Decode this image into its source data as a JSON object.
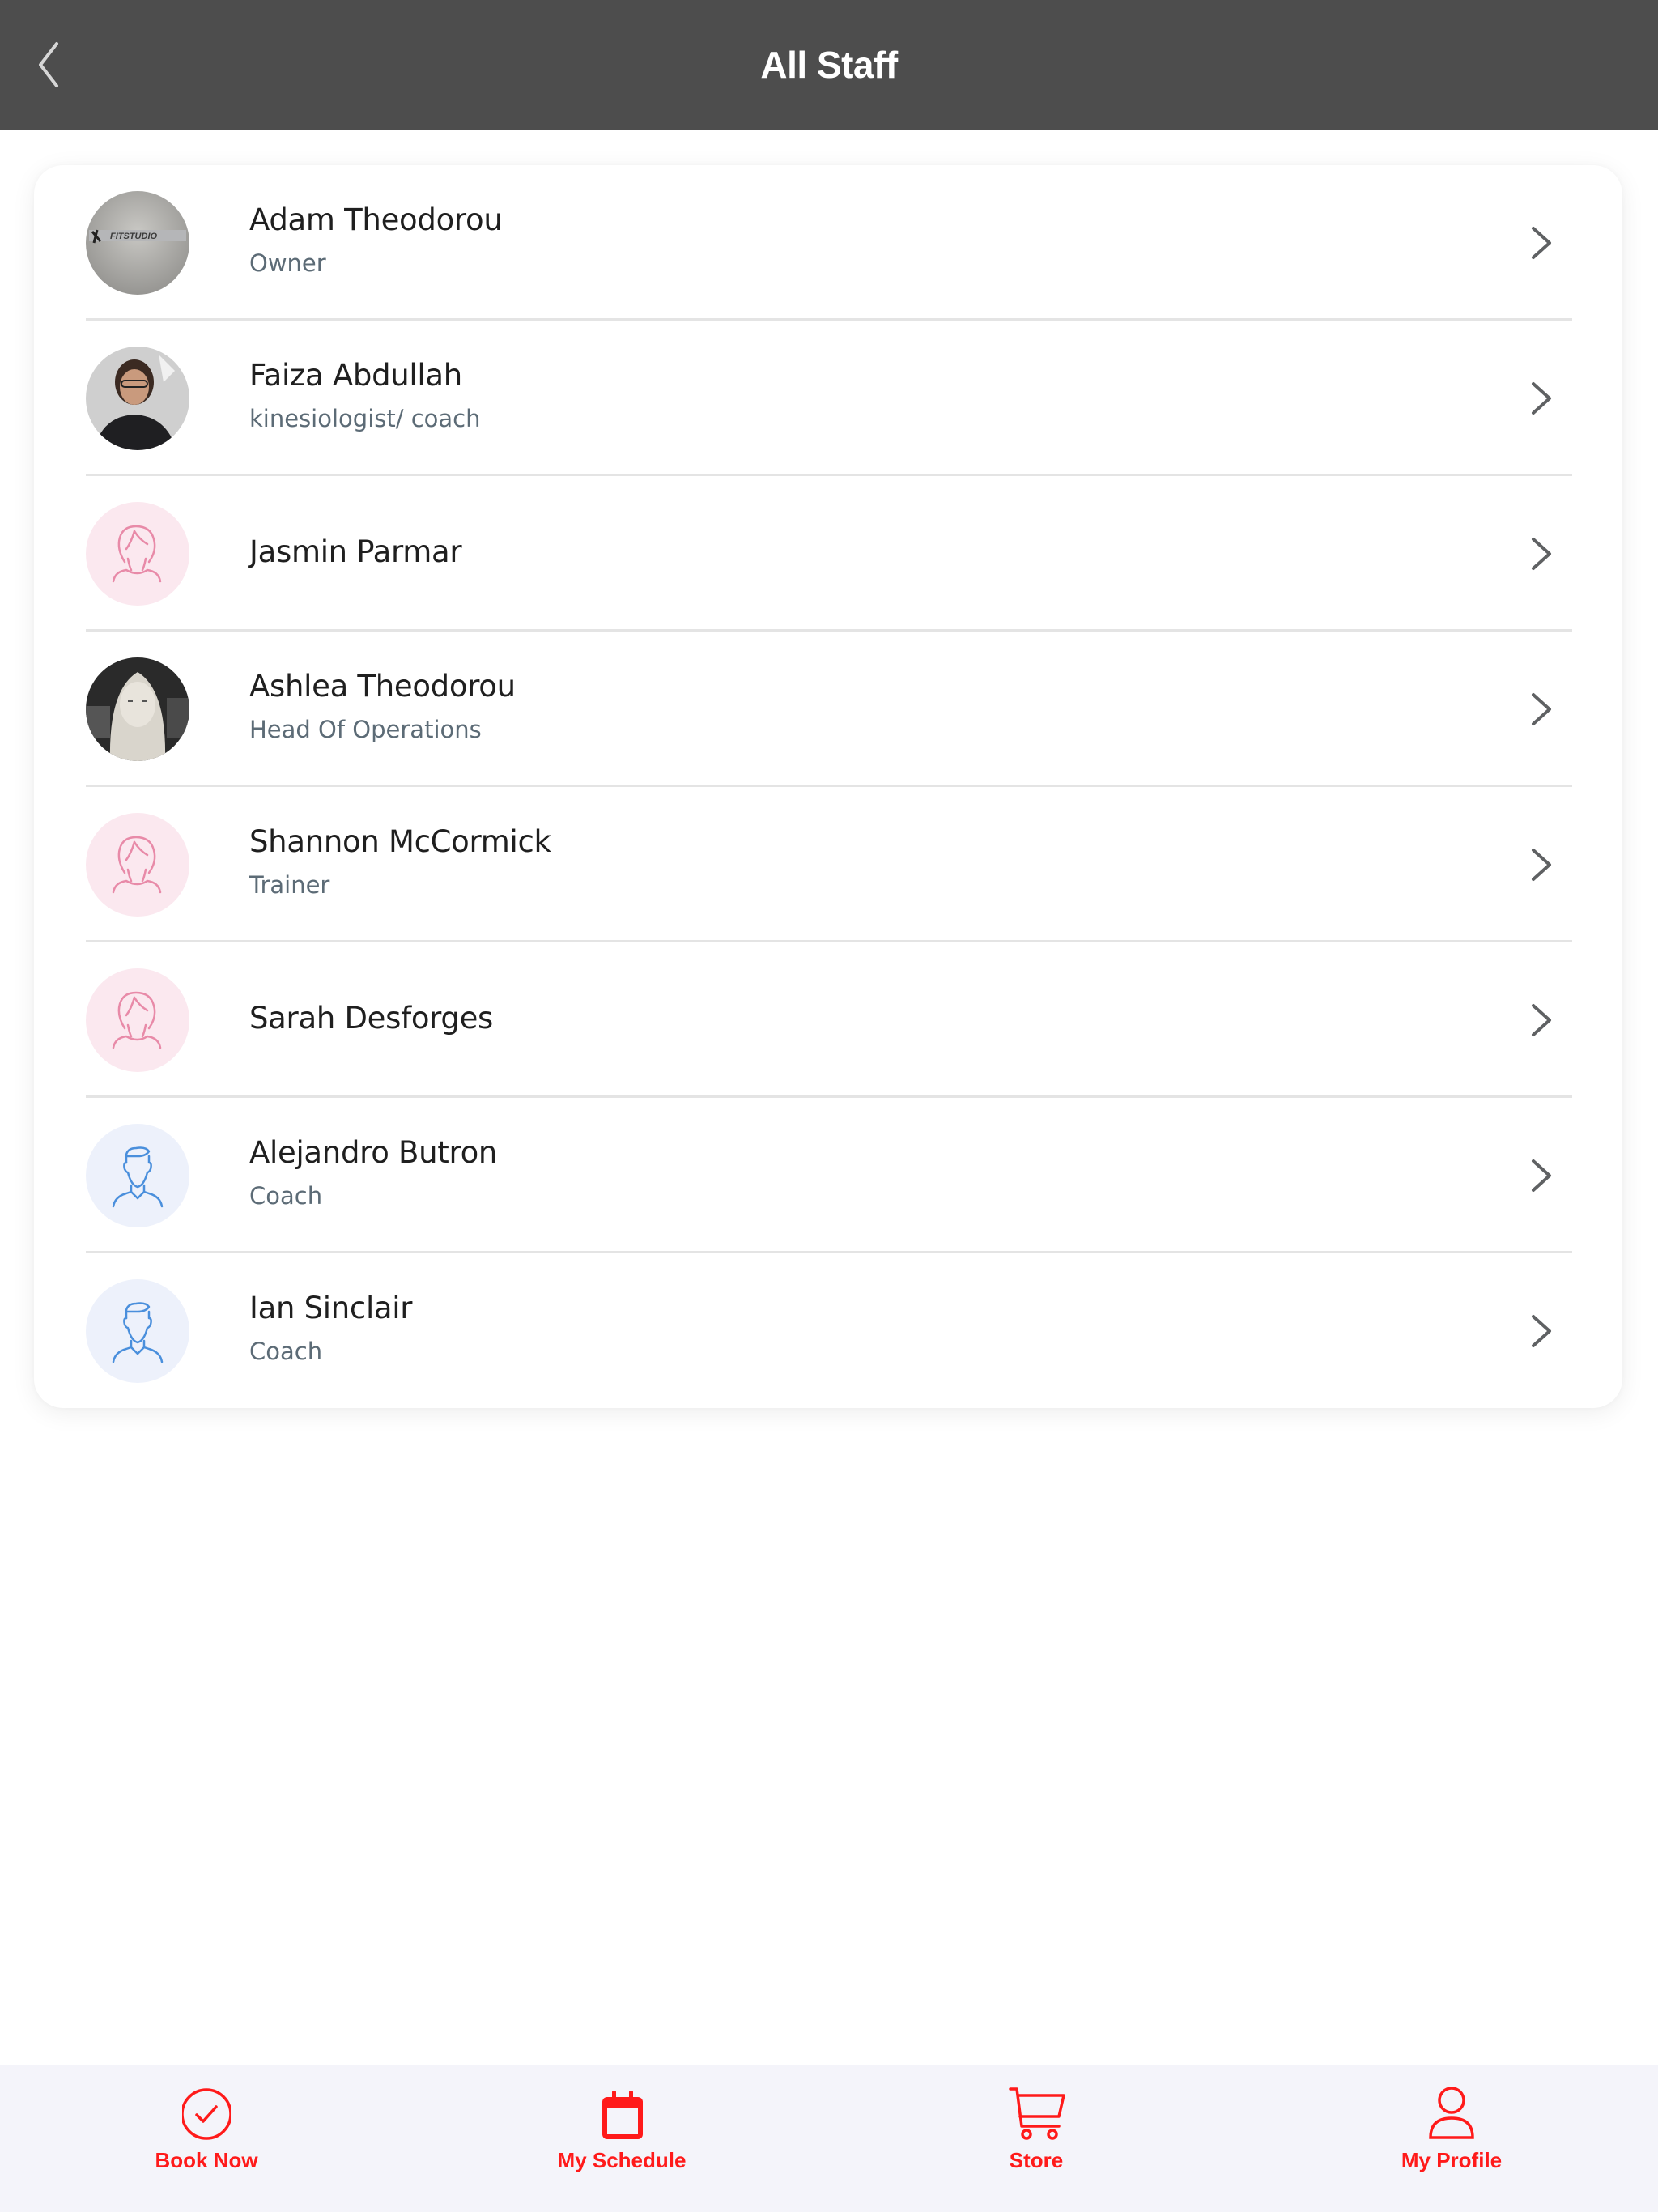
{
  "header": {
    "title": "All Staff",
    "back_icon": "chevron-left-icon"
  },
  "staff": [
    {
      "name": "Adam Theodorou",
      "role": "Owner",
      "avatar": "photo-studio-logo"
    },
    {
      "name": "Faiza Abdullah",
      "role": "kinesiologist/ coach",
      "avatar": "photo-woman"
    },
    {
      "name": "Jasmin Parmar",
      "role": "",
      "avatar": "female-placeholder-icon"
    },
    {
      "name": "Ashlea Theodorou",
      "role": "Head Of Operations",
      "avatar": "photo-woman-bw"
    },
    {
      "name": "Shannon McCormick",
      "role": "Trainer",
      "avatar": "female-placeholder-icon"
    },
    {
      "name": "Sarah Desforges",
      "role": "",
      "avatar": "female-placeholder-icon"
    },
    {
      "name": "Alejandro Butron",
      "role": "Coach",
      "avatar": "male-placeholder-icon"
    },
    {
      "name": "Ian Sinclair",
      "role": "Coach",
      "avatar": "male-placeholder-icon"
    }
  ],
  "tabbar": {
    "tabs": [
      {
        "label": "Book Now",
        "icon": "check-circle-icon"
      },
      {
        "label": "My Schedule",
        "icon": "calendar-icon"
      },
      {
        "label": "Store",
        "icon": "cart-icon"
      },
      {
        "label": "My Profile",
        "icon": "user-icon"
      }
    ]
  },
  "colors": {
    "header_bg": "#4d4d4d",
    "accent": "#ff1a1a",
    "female_placeholder_bg": "#fbe8ef",
    "female_placeholder_stroke": "#e88aa8",
    "male_placeholder_bg": "#edf1fb",
    "male_placeholder_stroke": "#4a8fdc",
    "tabbar_bg": "#f4f4fa"
  }
}
